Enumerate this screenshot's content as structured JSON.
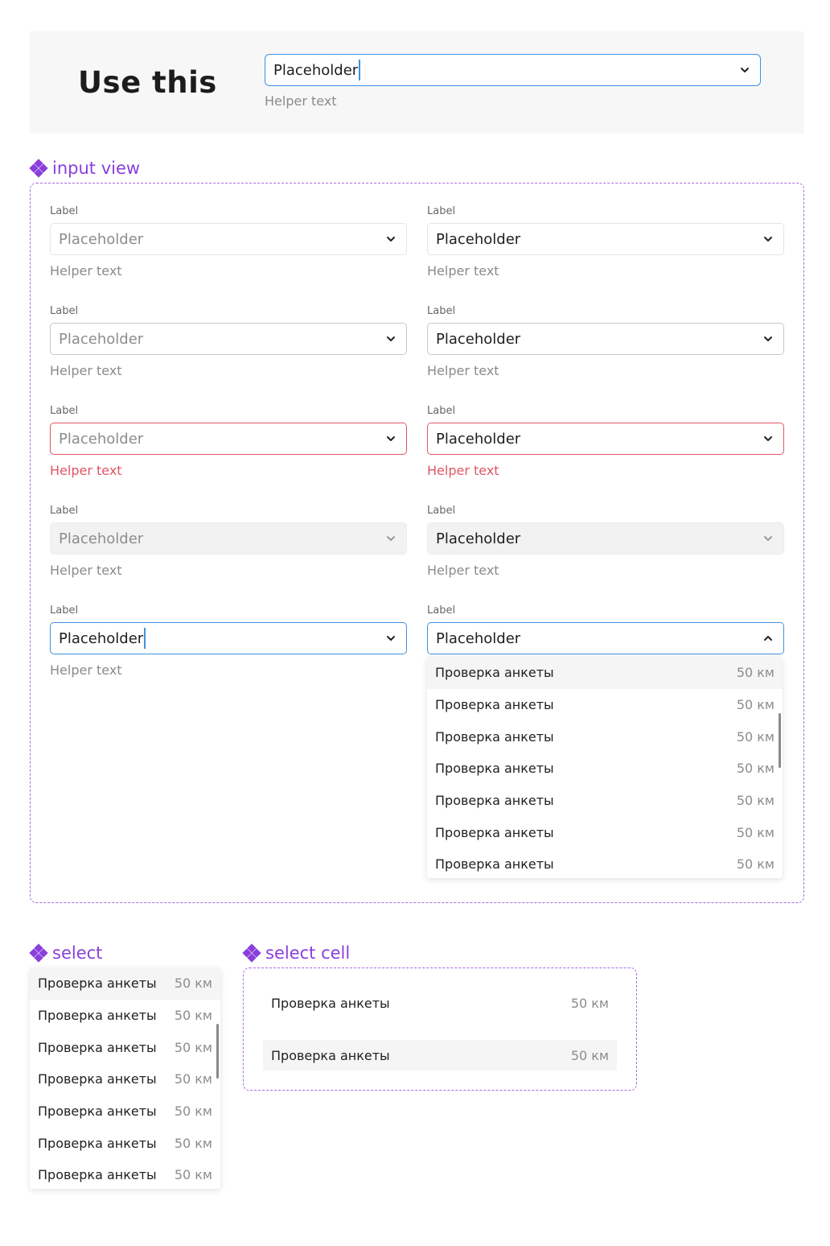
{
  "use_this": {
    "title": "Use this",
    "value": "Placeholder",
    "helper": "Helper text"
  },
  "input_view": {
    "title": "input view",
    "fields": [
      {
        "label": "Label",
        "value": "Placeholder",
        "helper": "Helper text",
        "state": "default-placeholder"
      },
      {
        "label": "Label",
        "value": "Placeholder",
        "helper": "Helper text",
        "state": "default-filled"
      },
      {
        "label": "Label",
        "value": "Placeholder",
        "helper": "Helper text",
        "state": "outlined-placeholder"
      },
      {
        "label": "Label",
        "value": "Placeholder",
        "helper": "Helper text",
        "state": "outlined-filled"
      },
      {
        "label": "Label",
        "value": "Placeholder",
        "helper": "Helper text",
        "state": "error-placeholder"
      },
      {
        "label": "Label",
        "value": "Placeholder",
        "helper": "Helper text",
        "state": "error-filled"
      },
      {
        "label": "Label",
        "value": "Placeholder",
        "helper": "Helper text",
        "state": "disabled-placeholder"
      },
      {
        "label": "Label",
        "value": "Placeholder",
        "helper": "Helper text",
        "state": "disabled-filled"
      },
      {
        "label": "Label",
        "value": "Placeholder",
        "helper": "Helper text",
        "state": "focus-typing"
      },
      {
        "label": "Label",
        "value": "Placeholder",
        "state": "open"
      }
    ],
    "dropdown_options": [
      {
        "label": "Проверка анкеты",
        "distance": "50 км"
      },
      {
        "label": "Проверка анкеты",
        "distance": "50 км"
      },
      {
        "label": "Проверка анкеты",
        "distance": "50 км"
      },
      {
        "label": "Проверка анкеты",
        "distance": "50 км"
      },
      {
        "label": "Проверка анкеты",
        "distance": "50 км"
      },
      {
        "label": "Проверка анкеты",
        "distance": "50 км"
      },
      {
        "label": "Проверка анкеты",
        "distance": "50 км"
      }
    ]
  },
  "select": {
    "title": "select",
    "options": [
      {
        "label": "Проверка анкеты",
        "distance": "50 км"
      },
      {
        "label": "Проверка анкеты",
        "distance": "50 км"
      },
      {
        "label": "Проверка анкеты",
        "distance": "50 км"
      },
      {
        "label": "Проверка анкеты",
        "distance": "50 км"
      },
      {
        "label": "Проверка анкеты",
        "distance": "50 км"
      },
      {
        "label": "Проверка анкеты",
        "distance": "50 км"
      },
      {
        "label": "Проверка анкеты",
        "distance": "50 км"
      }
    ]
  },
  "select_cell": {
    "title": "select cell",
    "cells": [
      {
        "label": "Проверка анкеты",
        "distance": "50 км",
        "state": "default"
      },
      {
        "label": "Проверка анкеты",
        "distance": "50 км",
        "state": "hover"
      }
    ]
  },
  "colors": {
    "accent": "#8a3fdc",
    "focus": "#3f91dc",
    "error": "#e05563",
    "panel_bg": "#f7f7f7"
  },
  "icons": {
    "component": "component-icon",
    "chevron_down": "chevron-down-icon",
    "chevron_up": "chevron-up-icon"
  }
}
